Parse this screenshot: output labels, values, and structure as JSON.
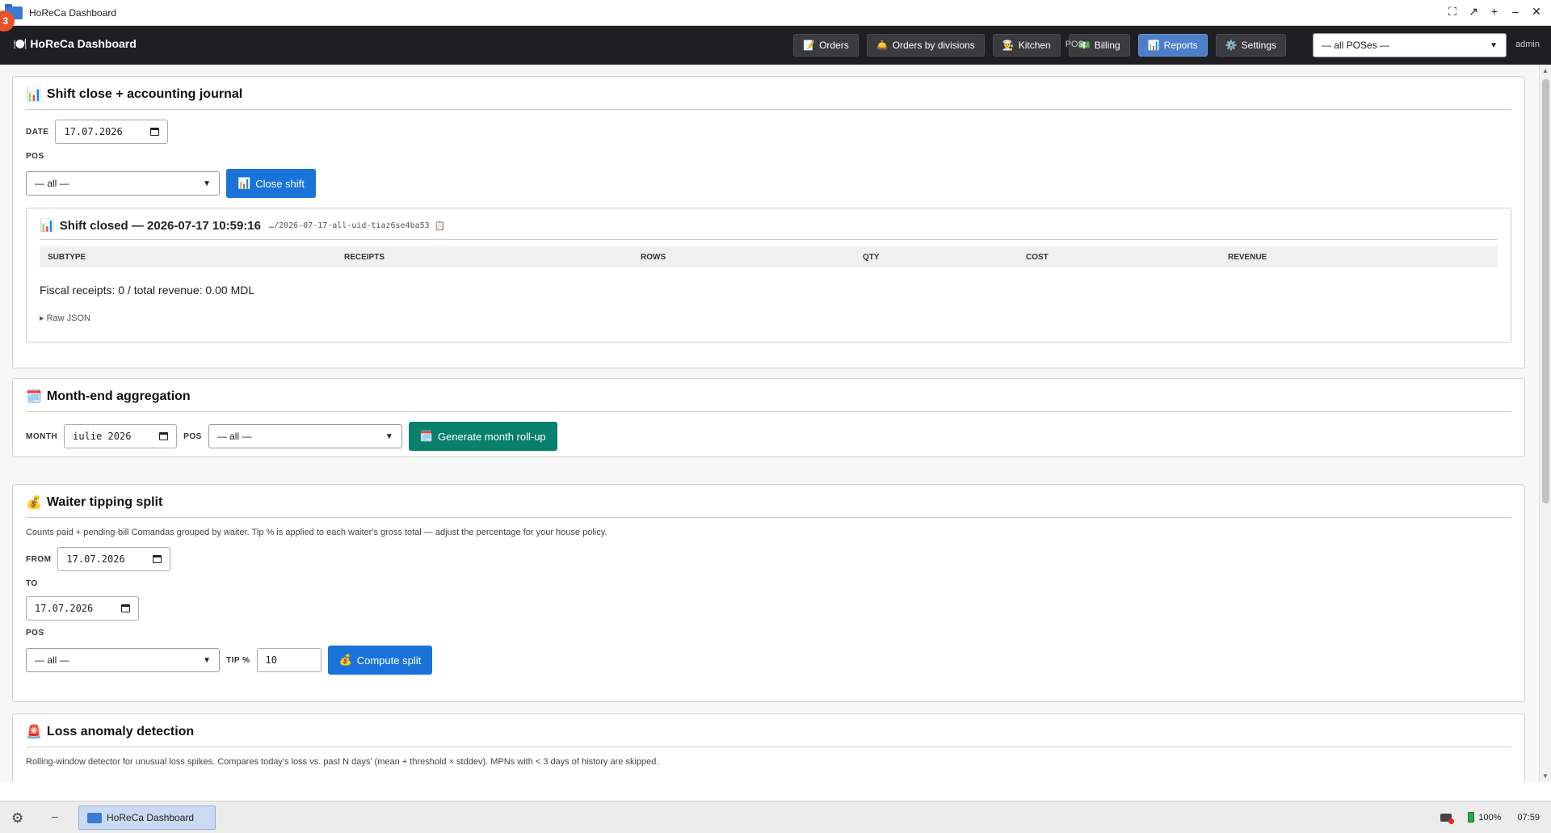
{
  "window": {
    "badge": "3",
    "title": "HoReCa Dashboard",
    "controls": [
      "⛶",
      "↗",
      "+",
      "–",
      "✕"
    ]
  },
  "header": {
    "brand": "🍽️ HoReCa Dashboard",
    "nav": [
      {
        "icon": "📝",
        "label": "Orders",
        "active": false
      },
      {
        "icon": "🛎️",
        "label": "Orders by divisions",
        "active": false
      },
      {
        "icon": "👨‍🍳",
        "label": "Kitchen",
        "active": false
      },
      {
        "icon": "💵",
        "label": "Billing",
        "active": false
      },
      {
        "icon": "📊",
        "label": "Reports",
        "active": true
      },
      {
        "icon": "⚙️",
        "label": "Settings",
        "active": false
      }
    ],
    "pos_label": "POS:",
    "pos_value": "— all POSes —",
    "user": "admin"
  },
  "shift": {
    "icon": "📊",
    "title": "Shift close + accounting journal",
    "date_label": "DATE",
    "date_value": "17.07.2026",
    "pos_label": "POS",
    "pos_value": "— all —",
    "button_icon": "📊",
    "button_label": "Close shift",
    "result": {
      "icon": "📊",
      "title": "Shift closed — 2026-07-17 10:59:16",
      "path": "…/2026-07-17-all-uid-tiaz6se4ba53",
      "copy_icon": "📋",
      "columns": [
        "SUBTYPE",
        "RECEIPTS",
        "ROWS",
        "QTY",
        "COST",
        "REVENUE"
      ],
      "summary": "Fiscal receipts: 0 / total revenue: 0.00 MDL",
      "raw_toggle": "▸ Raw JSON"
    }
  },
  "month": {
    "icon": "🗓️",
    "title": "Month-end aggregation",
    "month_label": "MONTH",
    "month_value": "iulie 2026",
    "pos_label": "POS",
    "pos_value": "— all —",
    "button_icon": "🗓️",
    "button_label": "Generate month roll-up"
  },
  "tips": {
    "icon": "💰",
    "title": "Waiter tipping split",
    "description": "Counts paid + pending-bill Comandas grouped by waiter. Tip % is applied to each waiter's gross total — adjust the percentage for your house policy.",
    "from_label": "FROM",
    "from_value": "17.07.2026",
    "to_label": "TO",
    "to_value": "17.07.2026",
    "pos_label": "POS",
    "pos_value": "— all —",
    "tip_label": "TIP %",
    "tip_value": "10",
    "button_icon": "💰",
    "button_label": "Compute split"
  },
  "loss": {
    "icon": "🚨",
    "title": "Loss anomaly detection",
    "description": "Rolling-window detector for unusual loss spikes. Compares today's loss vs. past N days' (mean + threshold × stddev). MPNs with < 3 days of history are skipped."
  },
  "taskbar": {
    "task_label": "HoReCa Dashboard",
    "battery": "100%",
    "time": "07:59"
  }
}
